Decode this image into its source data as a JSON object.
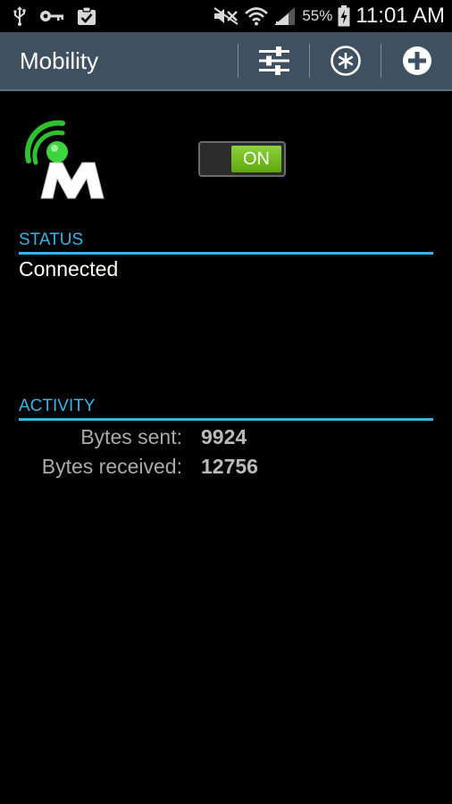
{
  "status_bar": {
    "icons_left": [
      "usb-icon",
      "key-icon",
      "clipboard-check-icon"
    ],
    "icons_right": [
      "mute-icon",
      "wifi-icon",
      "signal-icon",
      "battery-icon"
    ],
    "battery": "55%",
    "time": "11:01 AM"
  },
  "action_bar": {
    "title": "Mobility",
    "actions": [
      "settings-sliders-icon",
      "asterisk-circle-icon",
      "add-circle-icon"
    ]
  },
  "toggle": {
    "label": "ON",
    "state": "on"
  },
  "status": {
    "header": "STATUS",
    "value": "Connected"
  },
  "activity": {
    "header": "ACTIVITY",
    "bytes_sent_label": "Bytes sent:",
    "bytes_sent": "9924",
    "bytes_received_label": "Bytes received:",
    "bytes_received": "12756"
  },
  "colors": {
    "accent": "#33b5e5",
    "action_bar": "#3f5060",
    "toggle_on": "#6cbd1e",
    "logo_green": "#33cc33"
  }
}
